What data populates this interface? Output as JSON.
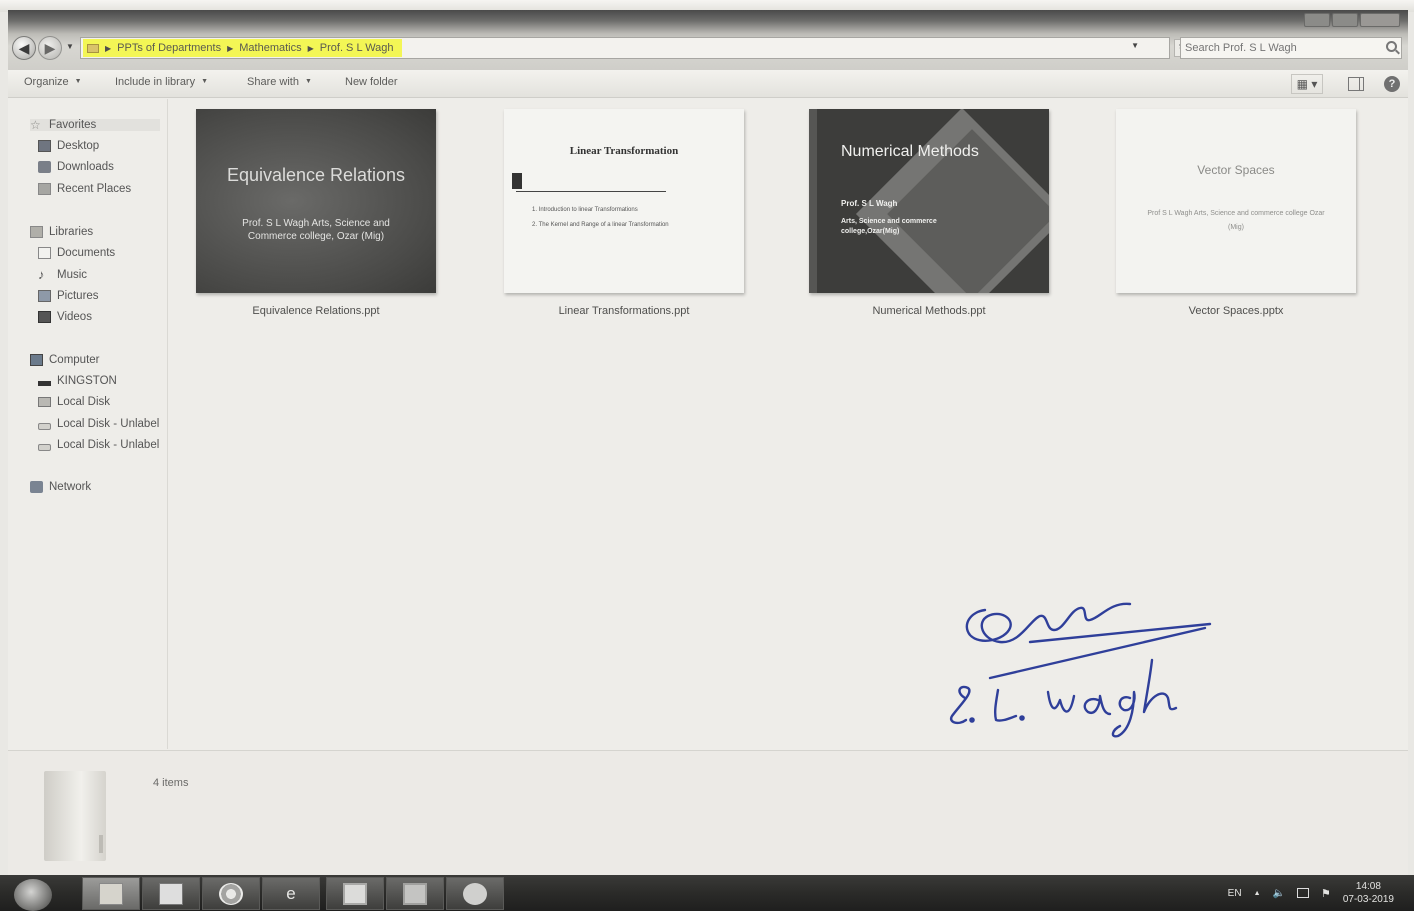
{
  "window": {
    "address": {
      "crumbs": [
        "PPTs of Departments",
        "Mathematics",
        "Prof. S L Wagh"
      ]
    },
    "search": {
      "placeholder": "Search Prof. S L Wagh"
    }
  },
  "toolbar": {
    "organize": "Organize",
    "include_in_library": "Include in library",
    "share_with": "Share with",
    "new_folder": "New folder"
  },
  "navpane": {
    "favorites": "Favorites",
    "desktop": "Desktop",
    "downloads": "Downloads",
    "recent_places": "Recent Places",
    "libraries": "Libraries",
    "documents": "Documents",
    "music": "Music",
    "pictures": "Pictures",
    "videos": "Videos",
    "computer": "Computer",
    "kingston": "KINGSTON",
    "local_disk": "Local Disk",
    "local_disk_unlabeled_1": "Local Disk - Unlabel",
    "local_disk_unlabeled_2": "Local Disk - Unlabel",
    "network": "Network"
  },
  "files": [
    {
      "name": "Equivalence Relations.ppt",
      "thumb_title": "Equivalence Relations",
      "thumb_sub": "Prof. S L Wagh Arts, Science and Commerce college, Ozar (Mig)"
    },
    {
      "name": "Linear Transformations.ppt",
      "thumb_title": "Linear Transformation",
      "thumb_bullet_1": "1. Introduction to linear Transformations",
      "thumb_bullet_2": "2. The Kernel and Range of a linear Transformation"
    },
    {
      "name": "Numerical Methods.ppt",
      "thumb_title": "Numerical Methods",
      "thumb_author": "Prof. S L Wagh",
      "thumb_sub": "Arts, Science and commerce college,Ozar(Mig)"
    },
    {
      "name": "Vector Spaces.pptx",
      "thumb_title": "Vector Spaces",
      "thumb_sub": "Prof S L Wagh Arts, Science and commerce college Ozar (Mig)"
    }
  ],
  "details": {
    "item_count": "4 items"
  },
  "taskbar": {
    "language": "EN",
    "time": "14:08",
    "date": "07-03-2019"
  },
  "signature": {
    "text": "S. L. Wagh"
  }
}
